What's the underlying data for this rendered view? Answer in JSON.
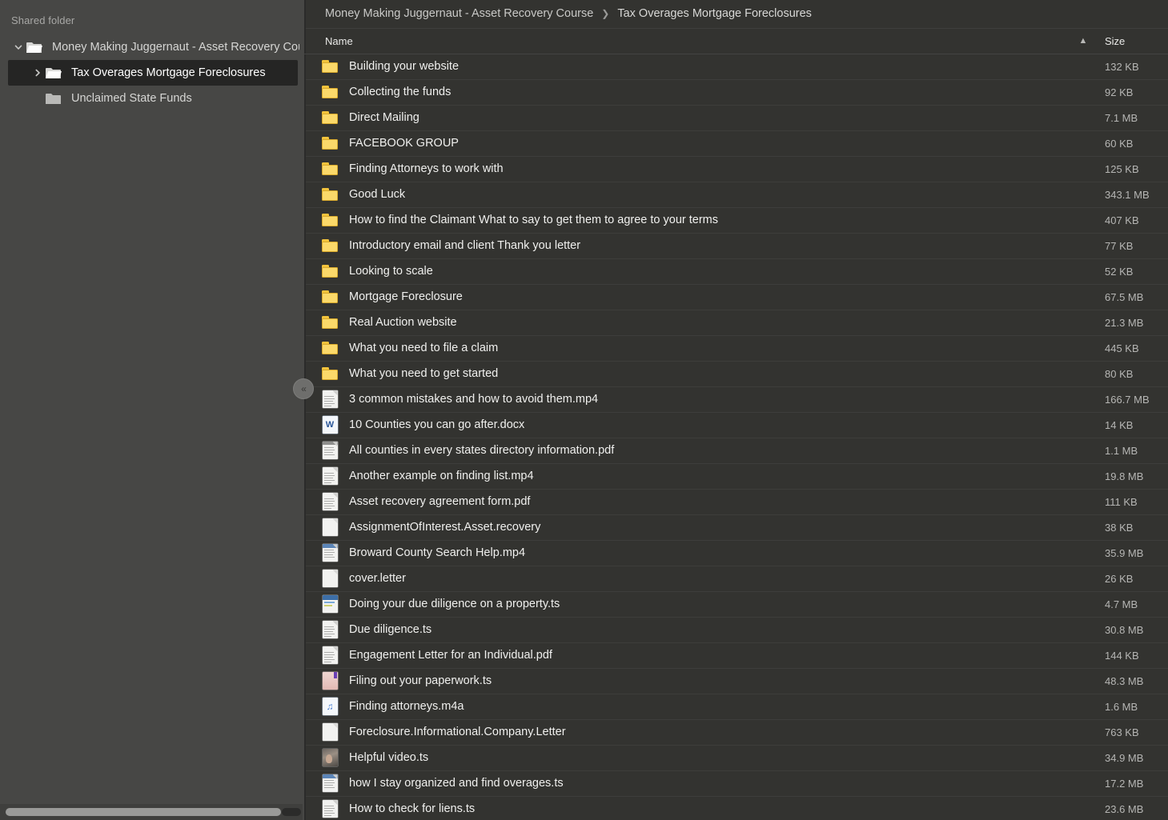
{
  "sidebar": {
    "shared_label": "Shared folder",
    "tree": [
      {
        "level": 0,
        "label": "Money Making Juggernaut - Asset Recovery Cou",
        "twisty": "chevron-down-icon",
        "selected": false,
        "icon": "folder-open-icon"
      },
      {
        "level": 1,
        "label": "Tax Overages Mortgage Foreclosures",
        "twisty": "chevron-right-icon",
        "selected": true,
        "icon": "folder-open-icon"
      },
      {
        "level": 1,
        "label": "Unclaimed State Funds",
        "twisty": "none",
        "selected": false,
        "icon": "folder-closed-icon"
      }
    ],
    "scrollbar": {
      "name": "sidebar-horizontal-scrollbar"
    }
  },
  "collapse_button": {
    "label": "«",
    "name": "collapse-sidebar-button"
  },
  "breadcrumb": {
    "root": "Money Making Juggernaut - Asset Recovery Course",
    "separator": "❯",
    "current": "Tax Overages Mortgage Foreclosures"
  },
  "columns": {
    "name": "Name",
    "sort_indicator": "▲",
    "size": "Size"
  },
  "files": [
    {
      "name": "Building your website",
      "size": "132 KB",
      "icon": "folder"
    },
    {
      "name": "Collecting the funds",
      "size": "92 KB",
      "icon": "folder"
    },
    {
      "name": "Direct Mailing",
      "size": "7.1 MB",
      "icon": "folder"
    },
    {
      "name": "FACEBOOK GROUP",
      "size": "60 KB",
      "icon": "folder"
    },
    {
      "name": "Finding Attorneys to work with",
      "size": "125 KB",
      "icon": "folder"
    },
    {
      "name": "Good Luck",
      "size": "343.1 MB",
      "icon": "folder"
    },
    {
      "name": "How to find the Claimant What to say to get them to agree to your terms",
      "size": "407 KB",
      "icon": "folder"
    },
    {
      "name": "Introductory email and client Thank you letter",
      "size": "77 KB",
      "icon": "folder"
    },
    {
      "name": "Looking to scale",
      "size": "52 KB",
      "icon": "folder"
    },
    {
      "name": "Mortgage Foreclosure",
      "size": "67.5 MB",
      "icon": "folder"
    },
    {
      "name": "Real Auction website",
      "size": "21.3 MB",
      "icon": "folder"
    },
    {
      "name": "What you need to file a claim",
      "size": "445 KB",
      "icon": "folder"
    },
    {
      "name": "What you need to get started",
      "size": "80 KB",
      "icon": "folder"
    },
    {
      "name": "3 common mistakes and how to avoid them.mp4",
      "size": "166.7 MB",
      "icon": "doc-thumb"
    },
    {
      "name": "10 Counties you can go after.docx",
      "size": "14 KB",
      "icon": "word-doc"
    },
    {
      "name": "All counties in every states directory information.pdf",
      "size": "1.1 MB",
      "icon": "doc-thumb-header-grey"
    },
    {
      "name": "Another example on finding list.mp4",
      "size": "19.8 MB",
      "icon": "doc-thumb"
    },
    {
      "name": "Asset recovery agreement form.pdf",
      "size": "111 KB",
      "icon": "doc-thumb"
    },
    {
      "name": "AssignmentOfInterest.Asset.recovery",
      "size": "38 KB",
      "icon": "blank-doc"
    },
    {
      "name": "Broward County Search Help.mp4",
      "size": "35.9 MB",
      "icon": "doc-thumb-header-blue"
    },
    {
      "name": "cover.letter",
      "size": "26 KB",
      "icon": "blank-doc"
    },
    {
      "name": "Doing your due diligence on a property.ts",
      "size": "4.7 MB",
      "icon": "blue-doc"
    },
    {
      "name": "Due diligence.ts",
      "size": "30.8 MB",
      "icon": "doc-thumb"
    },
    {
      "name": "Engagement Letter for an Individual.pdf",
      "size": "144 KB",
      "icon": "doc-thumb"
    },
    {
      "name": "Filing out your paperwork.ts",
      "size": "48.3 MB",
      "icon": "pink-doc"
    },
    {
      "name": "Finding attorneys.m4a",
      "size": "1.6 MB",
      "icon": "audio-file"
    },
    {
      "name": "Foreclosure.Informational.Company.Letter",
      "size": "763 KB",
      "icon": "blank-doc"
    },
    {
      "name": "Helpful video.ts",
      "size": "34.9 MB",
      "icon": "photo-thumb"
    },
    {
      "name": "how I stay organized and find overages.ts",
      "size": "17.2 MB",
      "icon": "doc-thumb-header-blue"
    },
    {
      "name": "How to check for liens.ts",
      "size": "23.6 MB",
      "icon": "doc-thumb"
    }
  ],
  "colors": {
    "sidebar_bg": "#474745",
    "main_bg": "#333330",
    "selected_row": "#252524",
    "folder_yellow": "#fbd96a",
    "text_primary": "#f0f0ee",
    "text_secondary": "#b6b6b4"
  }
}
